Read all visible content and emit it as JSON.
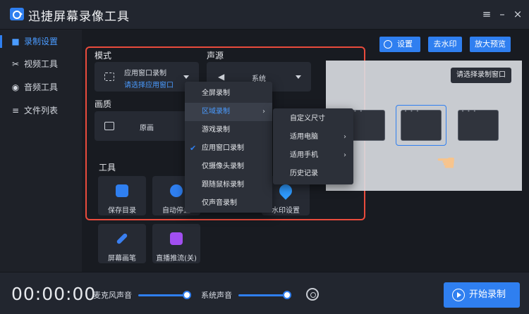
{
  "app": {
    "title": "迅捷屏幕录像工具"
  },
  "window_controls": {
    "menu": "≡",
    "minimize": "–",
    "close": "×"
  },
  "sidebar": {
    "items": [
      {
        "label": "录制设置",
        "icon": "record-icon",
        "active": true
      },
      {
        "label": "视频工具",
        "icon": "video-tools-icon",
        "active": false
      },
      {
        "label": "音频工具",
        "icon": "audio-tools-icon",
        "active": false
      },
      {
        "label": "文件列表",
        "icon": "file-list-icon",
        "active": false
      }
    ]
  },
  "top_buttons": {
    "settings": "设置",
    "remove_watermark": "去水印",
    "zoom_preview": "放大预览"
  },
  "mode": {
    "label": "模式",
    "value": "应用窗口录制",
    "sub": "请选择应用窗口"
  },
  "audio_source": {
    "label": "声源",
    "value": "系统"
  },
  "quality": {
    "label": "画质",
    "value": "原画"
  },
  "tools": {
    "label": "工具",
    "items": [
      {
        "label": "保存目录",
        "icon": "folder-icon"
      },
      {
        "label": "自动停止",
        "icon": "auto-stop-icon"
      },
      {
        "label": "水印设置",
        "icon": "watermark-icon"
      },
      {
        "label": "屏幕画笔",
        "icon": "pen-icon"
      },
      {
        "label": "直播推流(关)",
        "icon": "live-stream-icon"
      }
    ]
  },
  "mode_menu": {
    "items": [
      {
        "label": "全屏录制",
        "checked": false,
        "submenu": false,
        "hover": false
      },
      {
        "label": "区域录制",
        "checked": false,
        "submenu": true,
        "hover": true
      },
      {
        "label": "游戏录制",
        "checked": false,
        "submenu": false,
        "hover": false
      },
      {
        "label": "应用窗口录制",
        "checked": true,
        "submenu": false,
        "hover": false
      },
      {
        "label": "仅摄像头录制",
        "checked": false,
        "submenu": false,
        "hover": false
      },
      {
        "label": "跟随鼠标录制",
        "checked": false,
        "submenu": false,
        "hover": false
      },
      {
        "label": "仅声音录制",
        "checked": false,
        "submenu": false,
        "hover": false
      }
    ]
  },
  "region_submenu": {
    "items": [
      {
        "label": "自定义尺寸",
        "submenu": false
      },
      {
        "label": "适用电脑",
        "submenu": true
      },
      {
        "label": "适用手机",
        "submenu": true
      },
      {
        "label": "历史记录",
        "submenu": false
      }
    ]
  },
  "preview": {
    "tag": "请选择录制窗口"
  },
  "bottom": {
    "timer": "00:00:00",
    "mic_label": "麦克风声音",
    "system_label": "系统声音",
    "start_label": "开始录制"
  },
  "colors": {
    "accent": "#2f7ff0",
    "highlight_border": "#e94b3c"
  }
}
